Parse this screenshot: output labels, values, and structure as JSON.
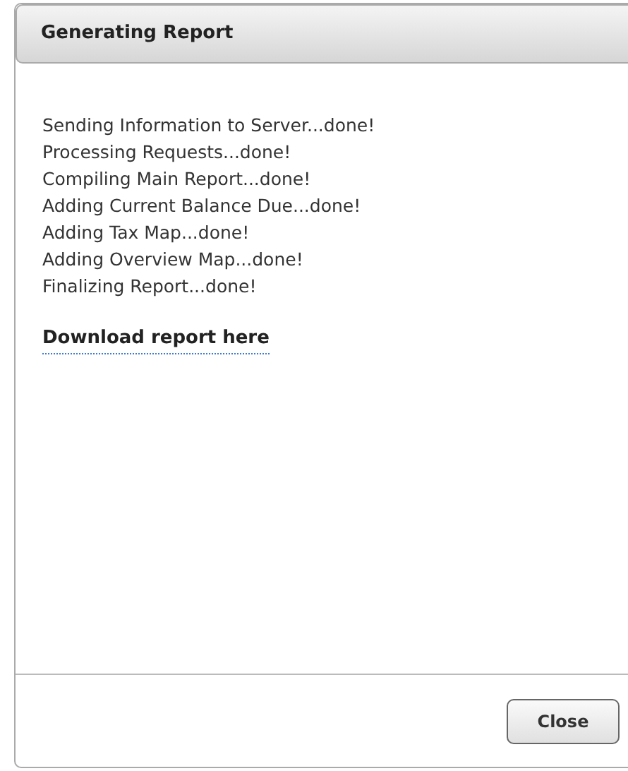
{
  "dialog": {
    "title": "Generating Report",
    "steps": [
      "Sending Information to Server...done!",
      "Processing Requests...done!",
      "Compiling Main Report...done!",
      "Adding Current Balance Due...done!",
      "Adding Tax Map...done!",
      "Adding Overview Map...done!",
      "Finalizing Report...done!"
    ],
    "link": "Download report here",
    "buttons": [
      "Close"
    ]
  }
}
